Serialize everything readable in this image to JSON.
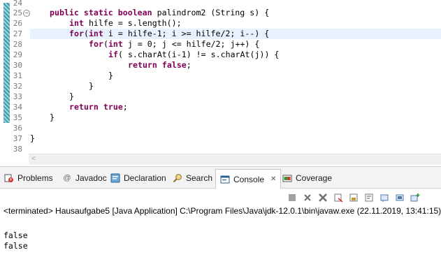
{
  "editor": {
    "lines": [
      {
        "no": "24",
        "text": ""
      },
      {
        "no": "25",
        "text": "public static boolean palindrom2 (String s) {"
      },
      {
        "no": "26",
        "text": "int hilfe = s.length();"
      },
      {
        "no": "27",
        "text": "for(int i = hilfe-1; i >= hilfe/2; i--) {"
      },
      {
        "no": "28",
        "text": "for(int j = 0; j <= hilfe/2; j++) {"
      },
      {
        "no": "29",
        "text": "if( s.charAt(i-1) != s.charAt(j)) {"
      },
      {
        "no": "30",
        "text": "return false;"
      },
      {
        "no": "31",
        "text": "}"
      },
      {
        "no": "32",
        "text": "}"
      },
      {
        "no": "33",
        "text": "}"
      },
      {
        "no": "34",
        "text": "return true;"
      },
      {
        "no": "35",
        "text": "}"
      },
      {
        "no": "36",
        "text": ""
      },
      {
        "no": "37",
        "text": "}"
      },
      {
        "no": "38",
        "text": ""
      }
    ],
    "scroll_arrow": "<"
  },
  "tabs": [
    {
      "label": "Problems",
      "icon": "problems-icon"
    },
    {
      "label": "Javadoc",
      "icon": "javadoc-icon",
      "glyph": "@"
    },
    {
      "label": "Declaration",
      "icon": "declaration-icon"
    },
    {
      "label": "Search",
      "icon": "search-icon"
    },
    {
      "label": "Console",
      "icon": "console-icon",
      "close": "✕",
      "active": true
    },
    {
      "label": "Coverage",
      "icon": "coverage-icon"
    }
  ],
  "console": {
    "header": "<terminated> Hausaufgabe5 [Java Application] C:\\Program Files\\Java\\jdk-12.0.1\\bin\\javaw.exe (22.11.2019, 13:41:15)",
    "output": [
      "false",
      "false"
    ]
  },
  "colors": {
    "keyword": "#7f0055",
    "current_line": "#e8f2fe",
    "gutter_marker": "#3e9bb0"
  }
}
